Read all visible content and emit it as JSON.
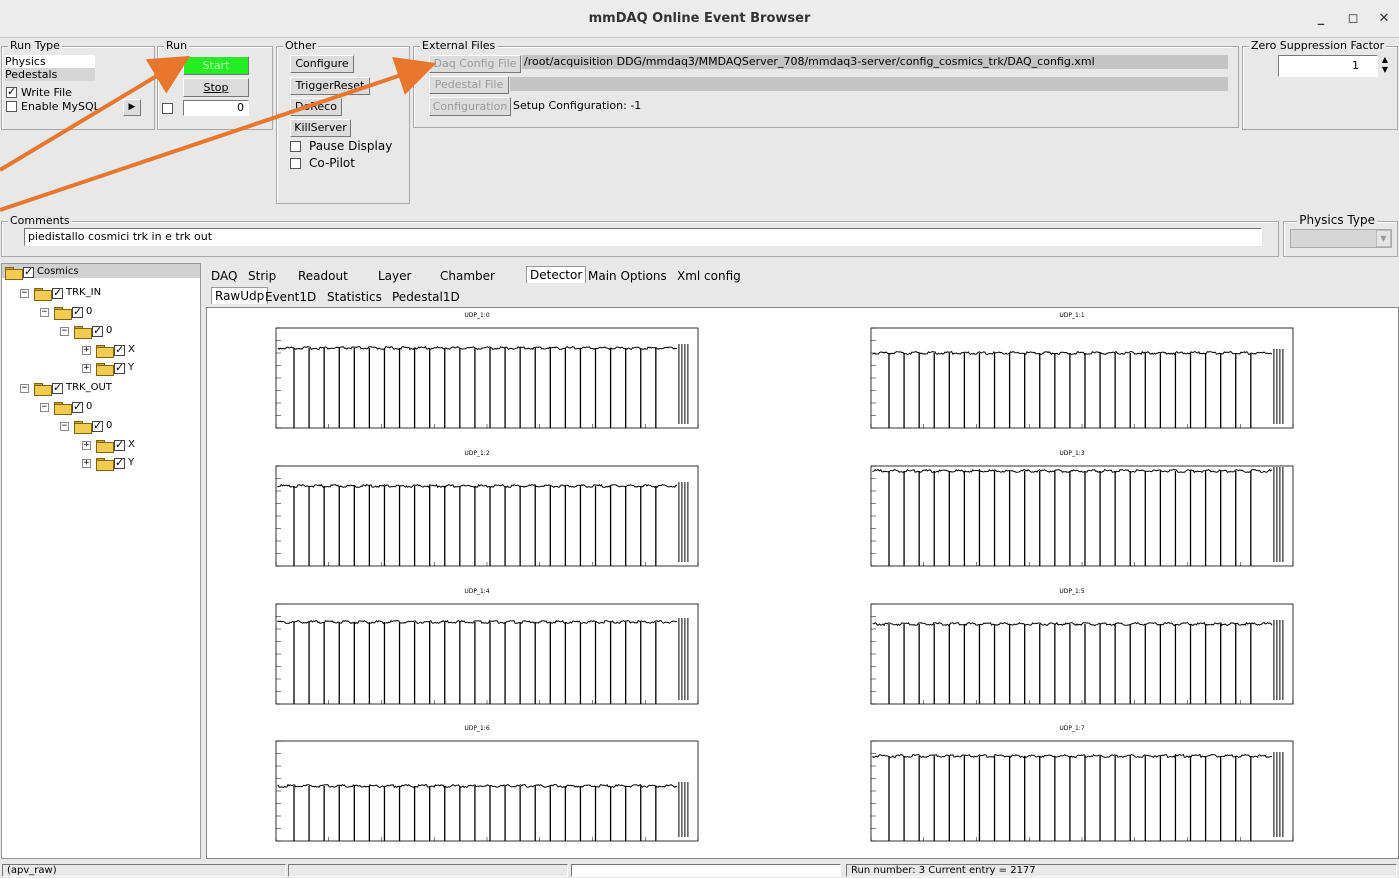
{
  "window": {
    "title": "mmDAQ Online Event Browser",
    "min_label": "_",
    "max_label": "◻",
    "close_label": "✕"
  },
  "run_type": {
    "legend": "Run Type",
    "options": [
      "Physics",
      "Pedestals"
    ],
    "selected": "Pedestals",
    "write_file": "Write File",
    "write_file_checked": true,
    "enable_mysql": "Enable MySQL",
    "enable_mysql_checked": false
  },
  "run": {
    "legend": "Run",
    "start": "Start",
    "stop": "Stop",
    "counter": "0"
  },
  "other": {
    "legend": "Other",
    "configure": "Configure",
    "trigger_reset": "TriggerReset",
    "doreco": "DoReco",
    "kill_server": "KillServer",
    "pause_display": "Pause Display",
    "co_pilot": "Co-Pilot"
  },
  "external_files": {
    "legend": "External Files",
    "daq_config_btn": "Daq Config File",
    "daq_config_path": "/root/acquisition DDG/mmdaq3/MMDAQServer_708/mmdaq3-server/config_cosmics_trk/DAQ_config.xml",
    "pedestal_btn": "Pedestal File",
    "pedestal_path": "",
    "configuration_btn": "Configuration",
    "setup_text": "Setup Configuration: -1"
  },
  "zero_suppression": {
    "legend": "Zero Suppression Factor",
    "value": "1"
  },
  "comments": {
    "legend": "Comments",
    "value": "piedistallo cosmici trk in e trk out"
  },
  "physics_type": {
    "legend": "Physics Type",
    "value": ""
  },
  "tree": {
    "root": "Cosmics",
    "groups": [
      {
        "label": "TRK_IN",
        "sub": "0",
        "subsub": "0",
        "leaves": [
          "X",
          "Y"
        ]
      },
      {
        "label": "TRK_OUT",
        "sub": "0",
        "subsub": "0",
        "leaves": [
          "X",
          "Y"
        ]
      }
    ]
  },
  "tabs": {
    "top": [
      "DAQ",
      "Strip",
      "Readout",
      "Layer",
      "Chamber",
      "Detector",
      "Main Options",
      "Xml config"
    ],
    "active_top": "Detector",
    "sub": [
      "RawUdp",
      "Event1D",
      "Statistics",
      "Pedestal1D"
    ],
    "active_sub": "RawUdp"
  },
  "plots": [
    {
      "title": "UDP_1:0",
      "baseline": 0.8,
      "drop": 0.62
    },
    {
      "title": "UDP_1:1",
      "baseline": 0.75,
      "drop": 0.62
    },
    {
      "title": "UDP_1:2",
      "baseline": 0.8,
      "drop": 0.62
    },
    {
      "title": "UDP_1:3",
      "baseline": 0.95,
      "drop": 0.62
    },
    {
      "title": "UDP_1:4",
      "baseline": 0.82,
      "drop": 0.62
    },
    {
      "title": "UDP_1:5",
      "baseline": 0.8,
      "drop": 0.62
    },
    {
      "title": "UDP_1:6",
      "baseline": 0.55,
      "drop": 0.62
    },
    {
      "title": "UDP_1:7",
      "baseline": 0.85,
      "drop": 0.62
    }
  ],
  "statusbar": {
    "left": "(apv_raw)",
    "mid": "",
    "run_info": "Run number: 3   Current entry = 2177"
  },
  "colors": {
    "start_green": "#22ee22",
    "arrow": "#e8762c",
    "bg": "#e8e8e8"
  }
}
